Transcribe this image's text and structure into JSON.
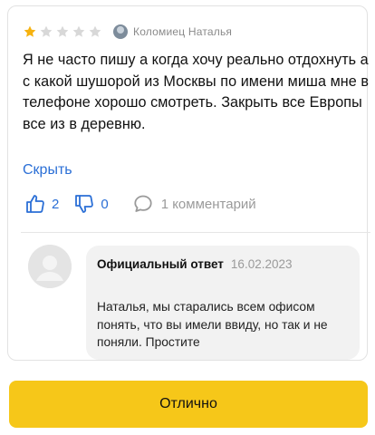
{
  "review": {
    "rating": 1,
    "max_rating": 5,
    "author": "Коломиец Наталья",
    "text": "Я не часто пишу а когда хочу реально отдохнуть а с какой шушорой из Москвы по имени миша мне в телефоне хорошо смотреть.  Закрыть все Европы все из в деревню.",
    "hide_label": "Скрыть",
    "likes": "2",
    "dislikes": "0",
    "comments": "1 комментарий"
  },
  "official_reply": {
    "title": "Официальный ответ",
    "date": "16.02.2023",
    "text": "Наталья, мы старались всем офисом понять, что вы имели ввиду, но так и не поняли. Простите"
  },
  "button": {
    "label": "Отлично"
  },
  "colors": {
    "star_filled": "#f6b20f",
    "star_empty": "#d8d8d8",
    "link": "#2b6fd6",
    "button_bg": "#f6c719"
  },
  "icons": {
    "like": "thumbs-up-icon",
    "dislike": "thumbs-down-icon",
    "comment": "speech-bubble-icon"
  }
}
